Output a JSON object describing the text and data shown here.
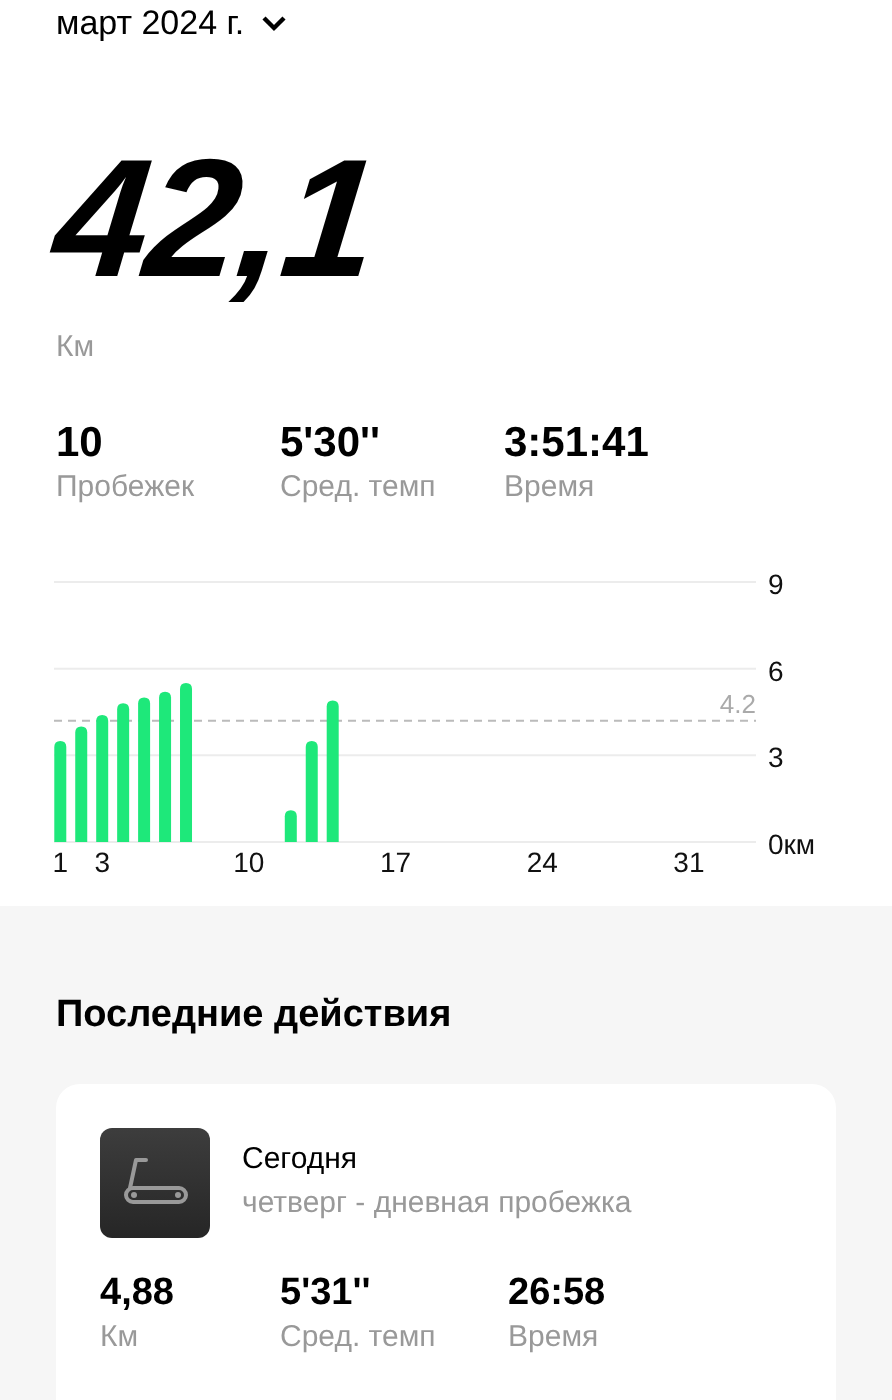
{
  "period": {
    "label": "март 2024 г.",
    "expanded": false
  },
  "total": {
    "value": "42,1",
    "unit": "Км"
  },
  "stats": [
    {
      "value": "10",
      "label": "Пробежек"
    },
    {
      "value": "5'30''",
      "label": "Сред. темп"
    },
    {
      "value": "3:51:41",
      "label": "Время"
    }
  ],
  "chart_data": {
    "type": "bar",
    "x": [
      1,
      2,
      3,
      4,
      5,
      6,
      7,
      12,
      13,
      14
    ],
    "series": [
      {
        "color": "#1ee87a",
        "values": [
          3.5,
          4.0,
          4.4,
          4.8,
          5.0,
          5.2,
          5.5,
          1.1,
          3.5,
          4.9
        ]
      }
    ],
    "xlim": [
      0.7,
      34.2
    ],
    "xticks": [
      1,
      3,
      10,
      17,
      24,
      31
    ],
    "ylim": [
      0,
      9
    ],
    "yticks": [
      {
        "value": 0,
        "label": "0км"
      },
      3,
      6,
      9
    ],
    "ref_lines": [
      {
        "axis": "y",
        "value": 4.2,
        "label": "4.2",
        "color": "#bbbbbb"
      }
    ]
  },
  "recent": {
    "title": "Последние действия",
    "activities": [
      {
        "kind": "treadmill",
        "title": "Сегодня",
        "subtitle": "четверг - дневная пробежка",
        "stats": [
          {
            "value": "4,88",
            "label": "Км"
          },
          {
            "value": "5'31''",
            "label": "Сред. темп"
          },
          {
            "value": "26:58",
            "label": "Время"
          }
        ]
      }
    ]
  }
}
